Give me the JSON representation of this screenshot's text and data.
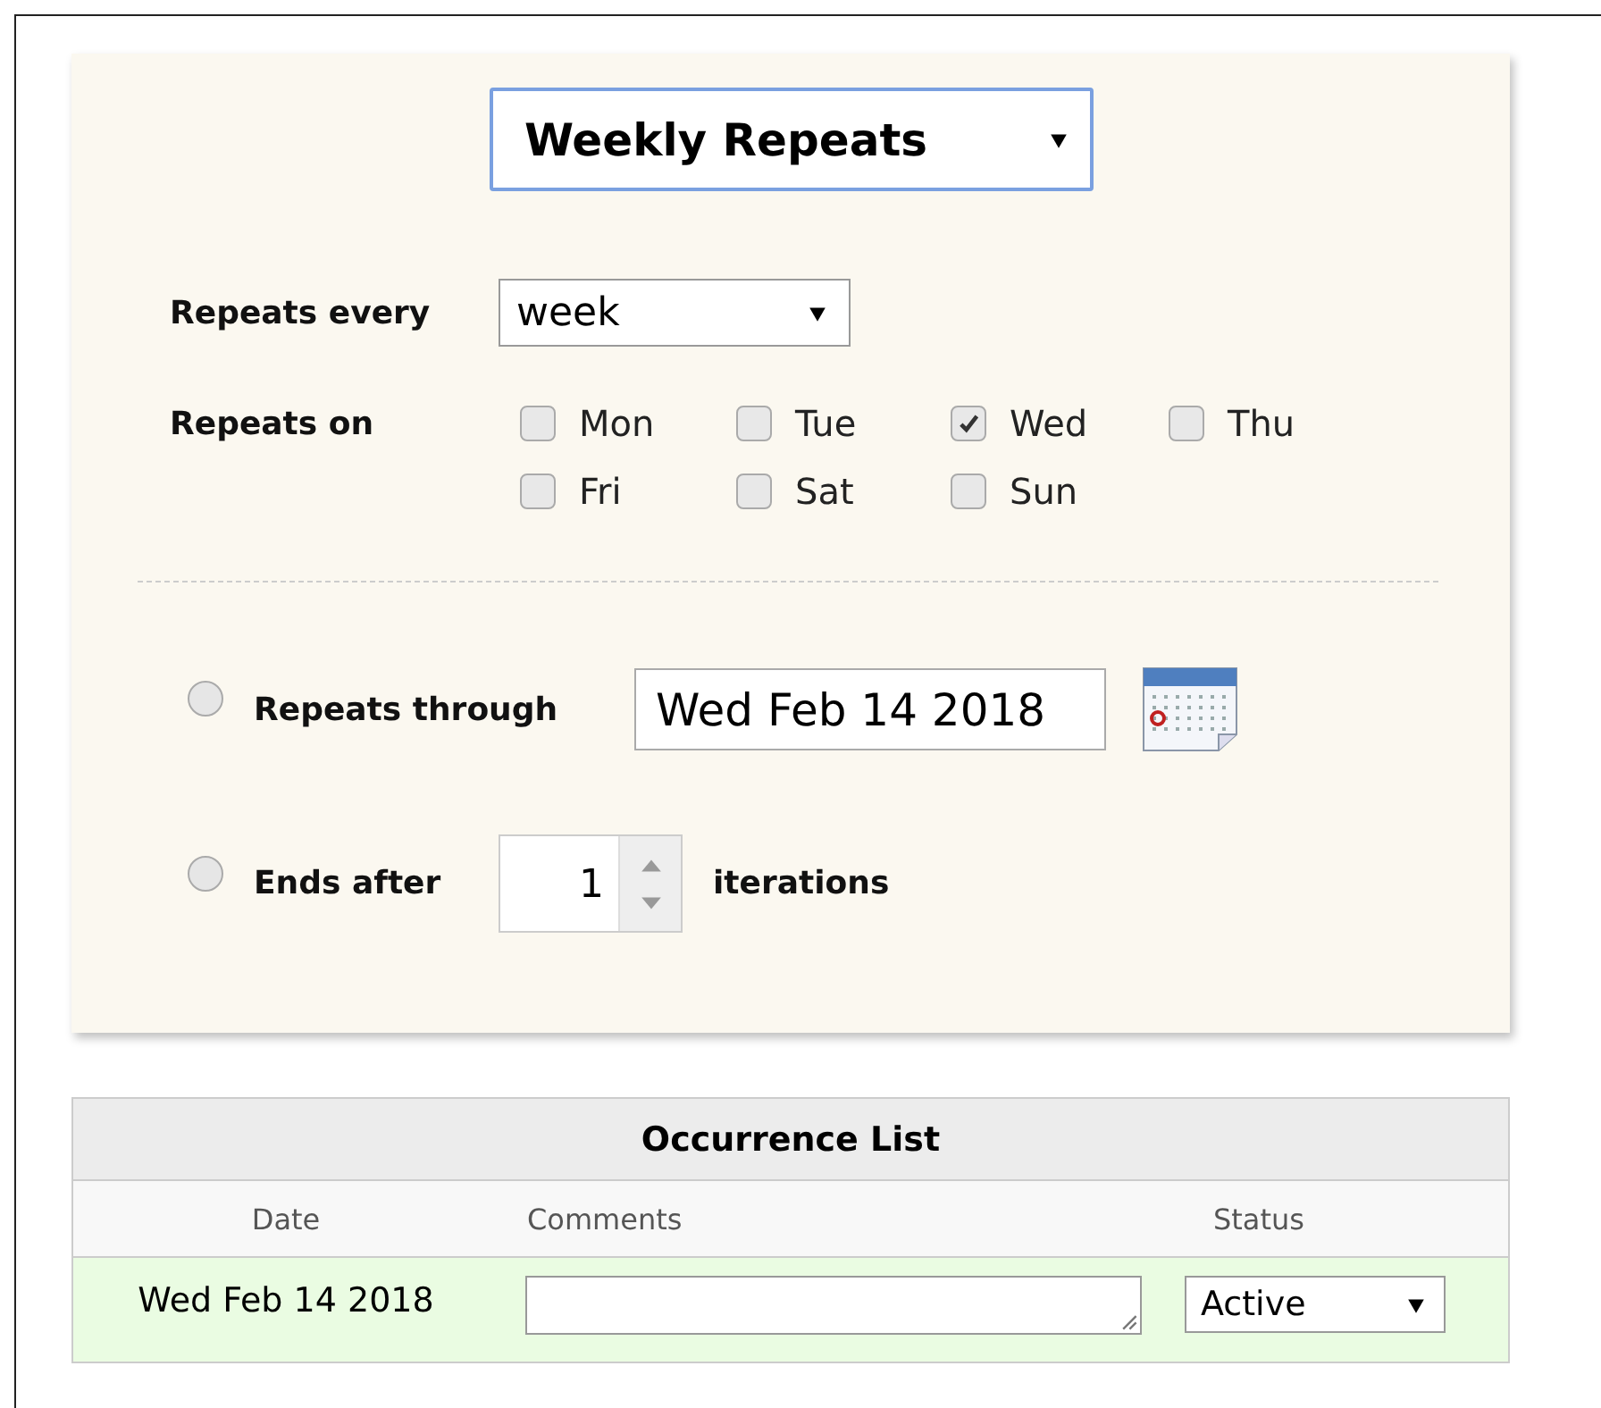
{
  "repeat_type": {
    "value": "Weekly Repeats"
  },
  "repeats_every": {
    "label": "Repeats every",
    "value": "week"
  },
  "repeats_on": {
    "label": "Repeats on",
    "days": [
      {
        "label": "Mon",
        "checked": false
      },
      {
        "label": "Tue",
        "checked": false
      },
      {
        "label": "Wed",
        "checked": true
      },
      {
        "label": "Thu",
        "checked": false
      },
      {
        "label": "Fri",
        "checked": false
      },
      {
        "label": "Sat",
        "checked": false
      },
      {
        "label": "Sun",
        "checked": false
      }
    ]
  },
  "end_options": [
    {
      "kind": "date",
      "label": "Repeats through",
      "selected": false,
      "value": "Wed Feb 14 2018"
    },
    {
      "kind": "count",
      "label": "Ends after",
      "selected": false,
      "value": "1",
      "suffix": "iterations"
    }
  ],
  "occurrence_list": {
    "title": "Occurrence List",
    "columns": [
      "Date",
      "Comments",
      "Status"
    ],
    "rows": [
      {
        "date": "Wed Feb 14 2018",
        "status": "Active"
      }
    ]
  }
}
